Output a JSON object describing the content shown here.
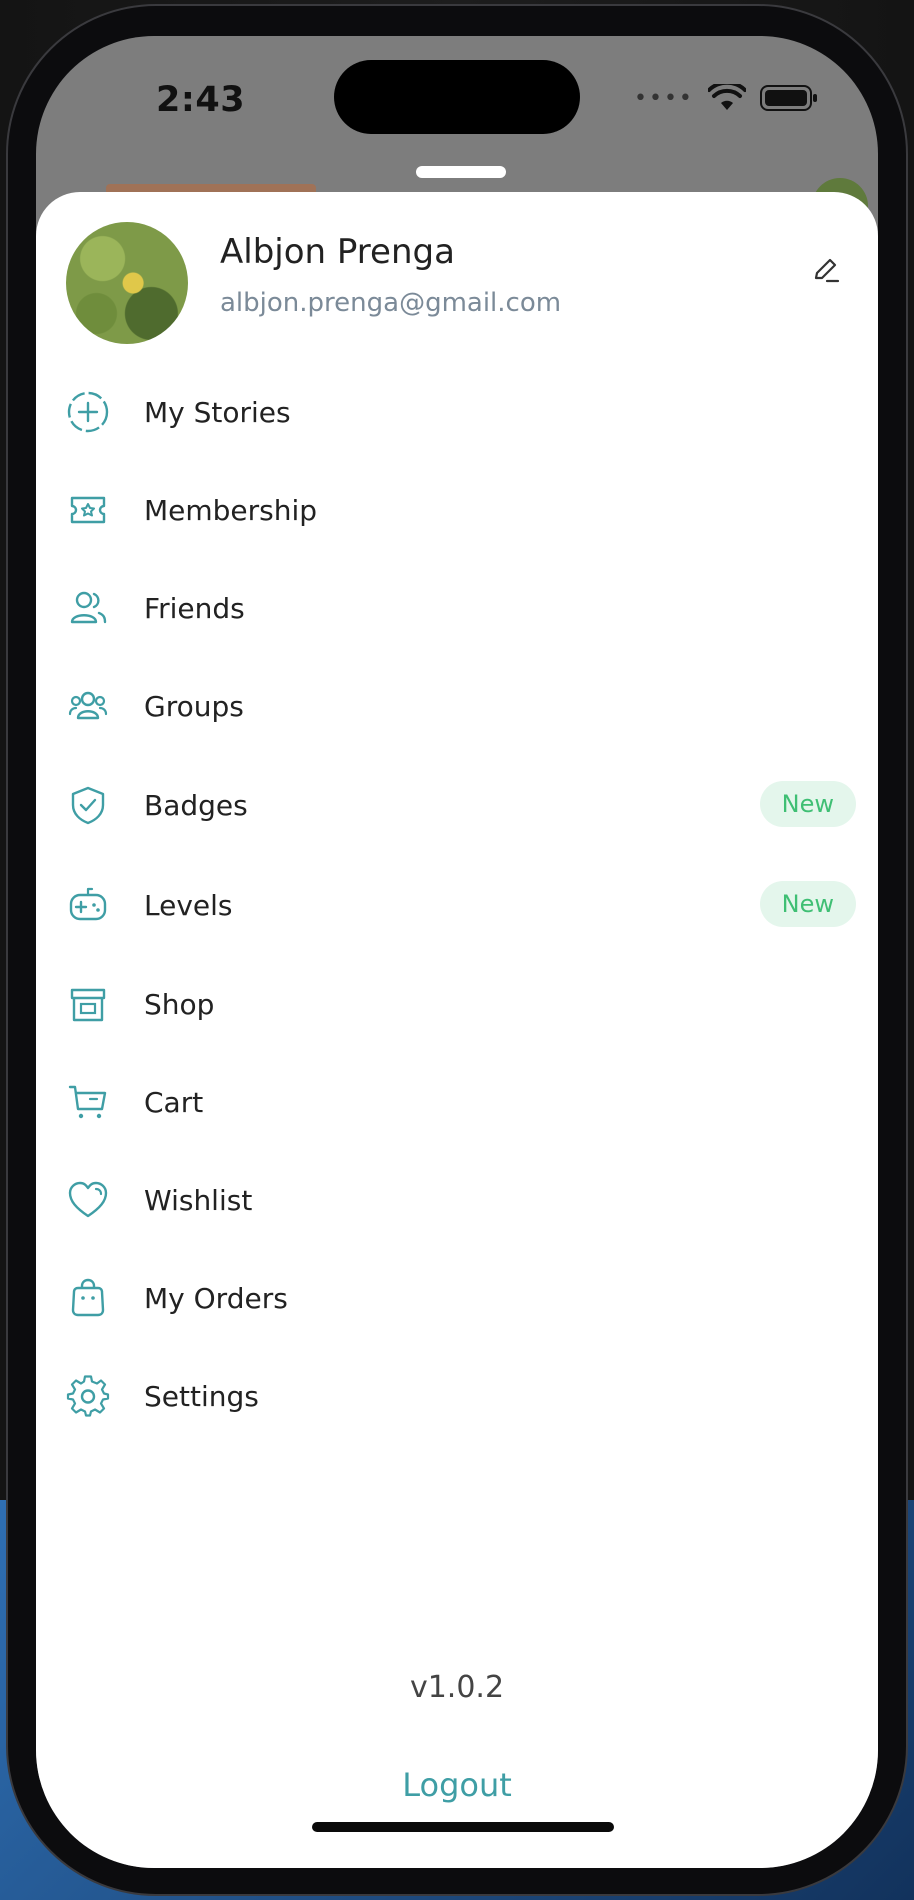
{
  "status_bar": {
    "time": "2:43"
  },
  "profile": {
    "name": "Albjon Prenga",
    "email": "albjon.prenga@gmail.com"
  },
  "menu": {
    "items": [
      {
        "label": "My Stories",
        "icon": "add-circle-dashed-icon",
        "badge": ""
      },
      {
        "label": "Membership",
        "icon": "ticket-star-icon",
        "badge": ""
      },
      {
        "label": "Friends",
        "icon": "users-icon",
        "badge": ""
      },
      {
        "label": "Groups",
        "icon": "group-icon",
        "badge": ""
      },
      {
        "label": "Badges",
        "icon": "shield-check-icon",
        "badge": "New"
      },
      {
        "label": "Levels",
        "icon": "gamepad-icon",
        "badge": "New"
      },
      {
        "label": "Shop",
        "icon": "shop-icon",
        "badge": ""
      },
      {
        "label": "Cart",
        "icon": "cart-icon",
        "badge": ""
      },
      {
        "label": "Wishlist",
        "icon": "heart-icon",
        "badge": ""
      },
      {
        "label": "My Orders",
        "icon": "bag-icon",
        "badge": ""
      },
      {
        "label": "Settings",
        "icon": "gear-icon",
        "badge": ""
      }
    ]
  },
  "footer": {
    "version": "v1.0.2",
    "logout_label": "Logout"
  },
  "colors": {
    "accent": "#3f9ea5",
    "badge_bg": "#e4f6ec",
    "badge_text": "#3fbf74"
  }
}
